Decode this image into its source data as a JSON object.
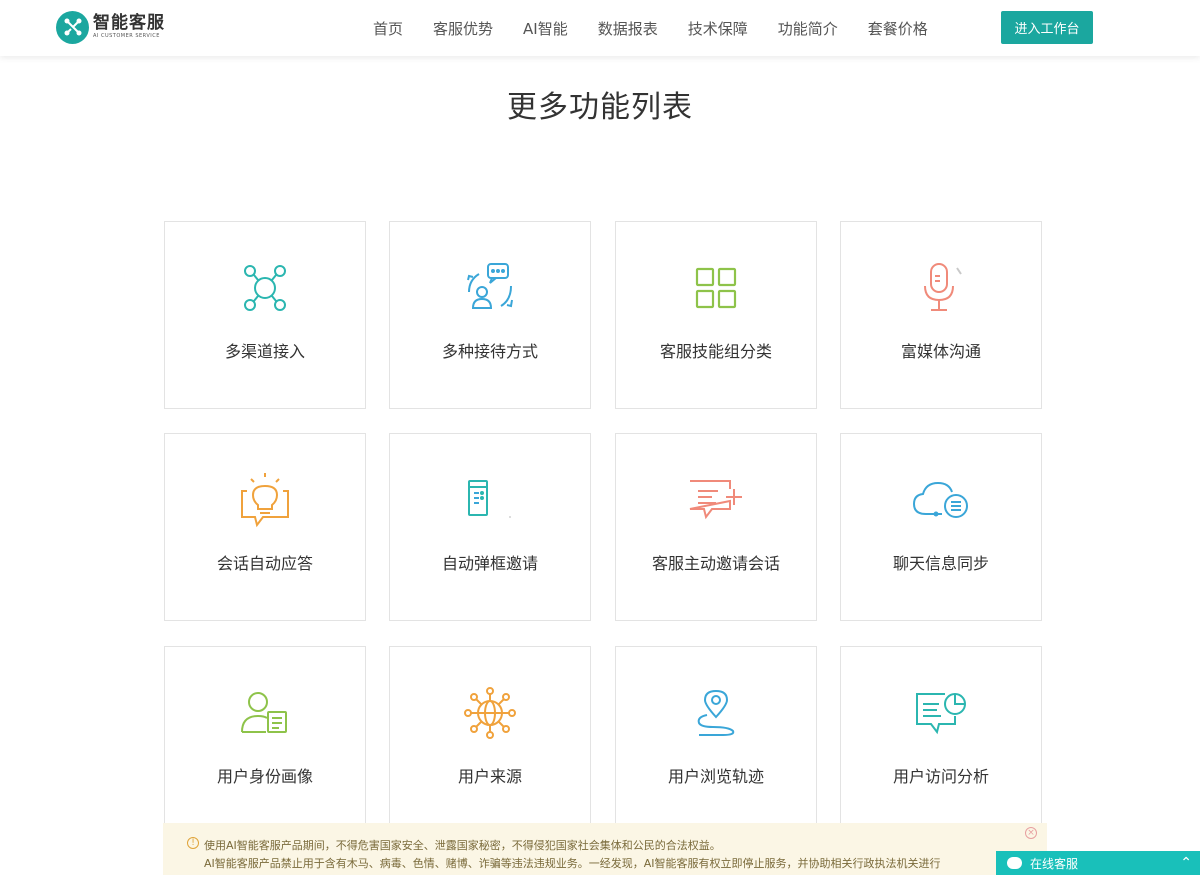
{
  "brand": {
    "name": "智能客服",
    "tagline": "AI CUSTOMER SERVICE"
  },
  "nav": [
    "首页",
    "客服优势",
    "AI智能",
    "数据报表",
    "技术保障",
    "功能简介",
    "套餐价格"
  ],
  "cta": "进入工作台",
  "section_title": "更多功能列表",
  "features": [
    {
      "label": "多渠道接入",
      "icon": "channels-network-icon",
      "color": "#2bb6b0"
    },
    {
      "label": "多种接待方式",
      "icon": "reception-user-chat-icon",
      "color": "#3aa6d8"
    },
    {
      "label": "客服技能组分类",
      "icon": "grid-four-icon",
      "color": "#8ec34a"
    },
    {
      "label": "富媒体沟通",
      "icon": "microphone-icon",
      "color": "#f08a7a"
    },
    {
      "label": "会话自动应答",
      "icon": "lightbulb-chat-icon",
      "color": "#f0a23c"
    },
    {
      "label": "自动弹框邀请",
      "icon": "popup-window-icon",
      "color": "#2bb6b0"
    },
    {
      "label": "客服主动邀请会话",
      "icon": "chat-plus-icon",
      "color": "#f08a7a"
    },
    {
      "label": "聊天信息同步",
      "icon": "cloud-sync-icon",
      "color": "#3aa6d8"
    },
    {
      "label": "用户身份画像",
      "icon": "user-profile-card-icon",
      "color": "#8ec34a"
    },
    {
      "label": "用户来源",
      "icon": "globe-network-icon",
      "color": "#f0a23c"
    },
    {
      "label": "用户浏览轨迹",
      "icon": "location-path-icon",
      "color": "#3aa6d8"
    },
    {
      "label": "用户访问分析",
      "icon": "chart-chat-icon",
      "color": "#2bb6b0"
    }
  ],
  "notice": {
    "line1": "使用AI智能客服产品期间，不得危害国家安全、泄露国家秘密，不得侵犯国家社会集体和公民的合法权益。",
    "line2": "AI智能客服产品禁止用于含有木马、病毒、色情、赌博、诈骗等违法违规业务。一经发现，AI智能客服有权立即停止服务，并协助相关行政执法机关进行"
  },
  "chat_widget": "在线客服"
}
